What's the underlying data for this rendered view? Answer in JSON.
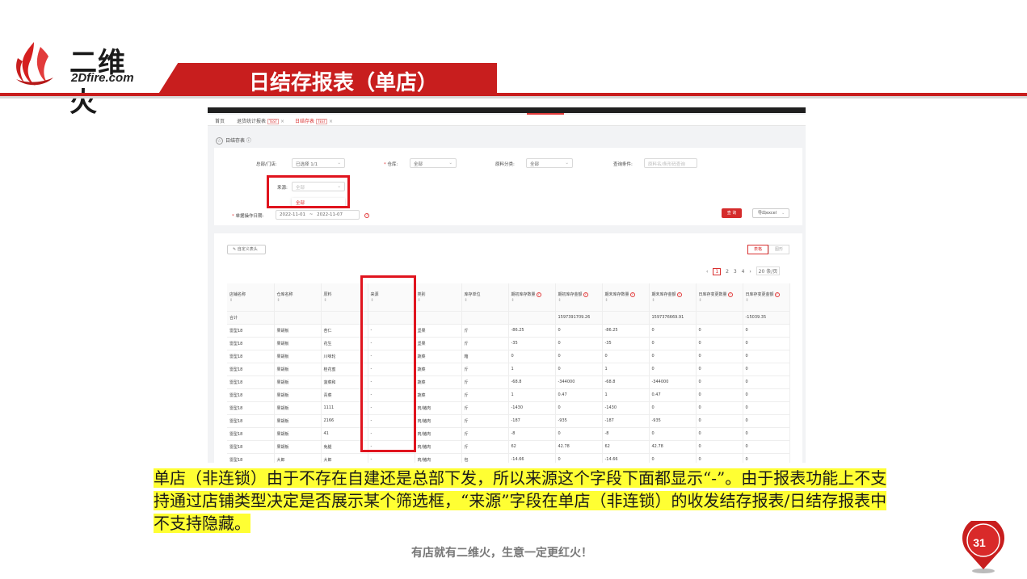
{
  "slide": {
    "logo_cn": "二维火",
    "logo_en": "2Dfire.com",
    "title": "日结存报表（单店）",
    "caption": "单店（非连锁）由于不存在自建还是总部下发，所以来源这个字段下面都显示“-”。由于报表功能上不支持通过店铺类型决定是否展示某个筛选框，“来源”字段在单店（非连锁）的收发结存报表/日结存报表中不支持隐藏。",
    "footer": "有店就有二维火，生意一定更红火！",
    "page_number": "31",
    "accent_color": "#c81e1e",
    "highlight_color": "#ffff33"
  },
  "app": {
    "tabs": [
      {
        "label": "首页"
      },
      {
        "label": "退货统计报表",
        "tag": "TEST",
        "close": "×"
      },
      {
        "label": "日结存表",
        "tag": "TEST",
        "close": "×"
      }
    ],
    "page_title": "日结存表 ⓘ",
    "filters": {
      "store_label": "总部/门店:",
      "store_value": "已选择 1/1",
      "warehouse_label": "仓库:",
      "warehouse_value": "全部",
      "category_label": "原料分类:",
      "category_value": "全部",
      "query_label": "查询条件:",
      "query_placeholder": "原料名/条形码查询",
      "source_label": "来源:",
      "source_value": "全部",
      "source_option": "全部",
      "date_label": "单据操作日期:",
      "date_start": "2022-11-01",
      "date_sep": "~",
      "date_end": "2022-11-07",
      "query_button": "查 询",
      "export_button": "导出excel"
    },
    "custom_header_button": "自定义表头",
    "view_toggle": [
      "表格",
      "图形"
    ],
    "pager": {
      "prev": "‹",
      "pages": [
        "1",
        "2",
        "3",
        "4"
      ],
      "next": "›",
      "size": "20 条/页"
    },
    "table": {
      "headers": [
        "店铺名称",
        "仓库名称",
        "原料",
        "来源",
        "类别",
        "库存单位",
        "期初库存数量",
        "期初库存金额",
        "期末库存数量",
        "期末库存金额",
        "日库存变更数量",
        "日库存变更金额"
      ],
      "summary": [
        "合计",
        "",
        "",
        "",
        "",
        "",
        "",
        "1597391709.26",
        "",
        "1597376669.91",
        "",
        "-15039.35"
      ],
      "rows": [
        [
          "雷型18",
          "果胡板",
          "杏仁",
          "-",
          "坚果",
          "斤",
          "-86.25",
          "0",
          "-86.25",
          "0",
          "0",
          "0"
        ],
        [
          "雷型18",
          "果胡板",
          "花生",
          "-",
          "坚果",
          "斤",
          "-35",
          "0",
          "-35",
          "0",
          "0",
          "0"
        ],
        [
          "雷型18",
          "果胡板",
          "川味轮",
          "-",
          "蔬菜",
          "箱",
          "0",
          "0",
          "0",
          "0",
          "0",
          "0"
        ],
        [
          "雷型18",
          "果胡板",
          "桂花蜜",
          "-",
          "蔬菜",
          "斤",
          "1",
          "0",
          "1",
          "0",
          "0",
          "0"
        ],
        [
          "雷型18",
          "果胡板",
          "菠菜和",
          "-",
          "蔬菜",
          "斤",
          "-68.8",
          "-344000",
          "-68.8",
          "-344000",
          "0",
          "0"
        ],
        [
          "雷型18",
          "果胡板",
          "青菜",
          "-",
          "蔬菜",
          "斤",
          "1",
          "0.47",
          "1",
          "0.47",
          "0",
          "0"
        ],
        [
          "雷型18",
          "果胡板",
          "1111",
          "-",
          "肉/猪肉",
          "斤",
          "-1430",
          "0",
          "-1430",
          "0",
          "0",
          "0"
        ],
        [
          "雷型18",
          "果胡板",
          "2166",
          "-",
          "肉/猪肉",
          "斤",
          "-187",
          "-935",
          "-187",
          "-935",
          "0",
          "0"
        ],
        [
          "雷型18",
          "果胡板",
          "41",
          "-",
          "肉/猪肉",
          "斤",
          "-8",
          "0",
          "-8",
          "0",
          "0",
          "0"
        ],
        [
          "雷型18",
          "果胡板",
          "免腿",
          "-",
          "肉/猪肉",
          "斤",
          "62",
          "42.78",
          "62",
          "42.78",
          "0",
          "0"
        ],
        [
          "雷型18",
          "大郎",
          "大郎",
          "-",
          "肉/猪肉",
          "包",
          "-14.66",
          "0",
          "-14.66",
          "0",
          "0",
          "0"
        ]
      ]
    }
  }
}
